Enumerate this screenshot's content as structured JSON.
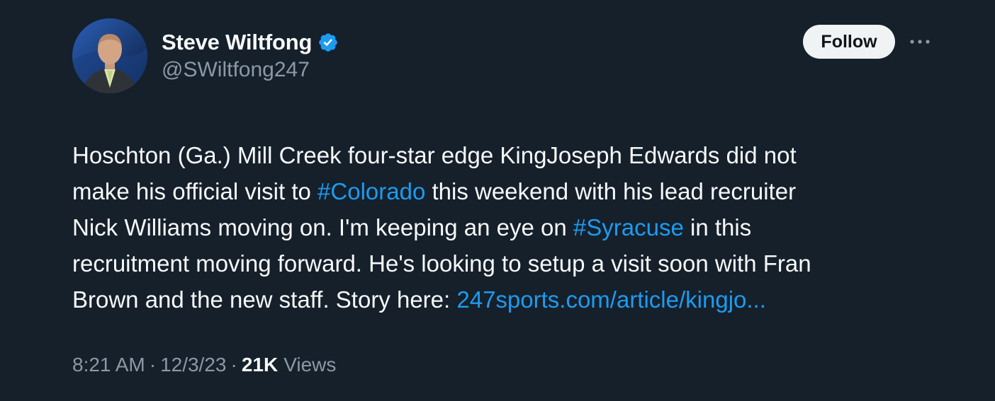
{
  "author": {
    "display_name": "Steve Wiltfong",
    "handle": "@SWiltfong247",
    "verified": true
  },
  "actions": {
    "follow_label": "Follow"
  },
  "tweet": {
    "lines": [
      [
        {
          "text": "Hoschton (Ga.) Mill Creek four-star edge KingJoseph Edwards did not",
          "link": false
        }
      ],
      [
        {
          "text": "make his official visit to ",
          "link": false
        },
        {
          "text": "#Colorado",
          "link": true
        },
        {
          "text": " this weekend with his lead recruiter",
          "link": false
        }
      ],
      [
        {
          "text": "Nick Williams moving on. I'm keeping an eye on ",
          "link": false
        },
        {
          "text": "#Syracuse",
          "link": true
        },
        {
          "text": " in this",
          "link": false
        }
      ],
      [
        {
          "text": "recruitment moving forward. He's looking to setup a visit soon with Fran",
          "link": false
        }
      ],
      [
        {
          "text": "Brown and the new staff. Story here: ",
          "link": false
        },
        {
          "text": "247sports.com/article/kingjo...",
          "link": true
        }
      ]
    ]
  },
  "meta": {
    "time": "8:21 AM",
    "separator": "·",
    "date": "12/3/23",
    "views_count": "21K",
    "views_label": "Views"
  },
  "colors": {
    "background": "#15202b",
    "link": "#1d9bf0",
    "verified": "#1d9bf0",
    "secondary_text": "#8b98a5"
  },
  "icons": {
    "verified": "verified-badge-icon",
    "more": "more-horizontal-icon"
  }
}
